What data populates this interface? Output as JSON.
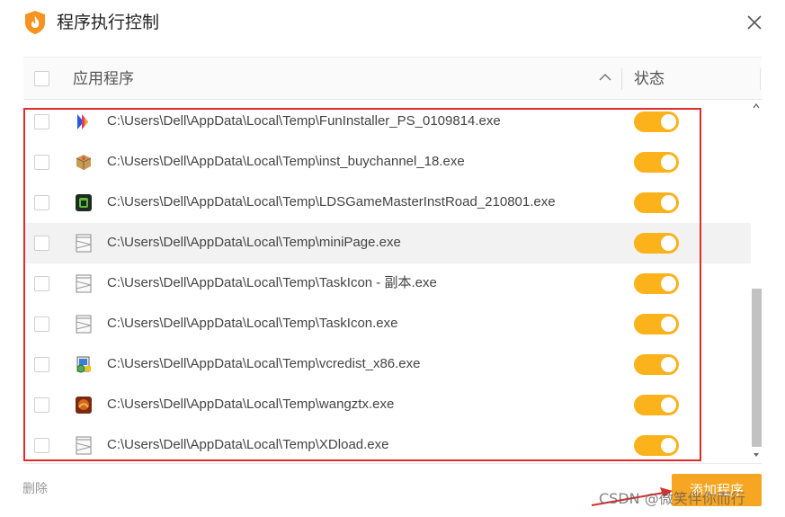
{
  "window": {
    "title": "程序执行控制",
    "icons": {
      "logo": "shield-flame-logo-icon",
      "close": "close-icon"
    }
  },
  "table": {
    "headers": {
      "app": "应用程序",
      "status": "状态"
    },
    "sort": "ascending",
    "rows": [
      {
        "path": "C:\\Users\\Dell\\AppData\\Local\\Temp\\FunInstaller_PS_0109814.exe",
        "icon": "funinstaller-app-icon",
        "checked": false,
        "enabled": true
      },
      {
        "path": "C:\\Users\\Dell\\AppData\\Local\\Temp\\inst_buychannel_18.exe",
        "icon": "package-box-icon",
        "checked": false,
        "enabled": true
      },
      {
        "path": "C:\\Users\\Dell\\AppData\\Local\\Temp\\LDSGameMasterInstRoad_210801.exe",
        "icon": "ldsgamemaster-app-icon",
        "checked": false,
        "enabled": true
      },
      {
        "path": "C:\\Users\\Dell\\AppData\\Local\\Temp\\miniPage.exe",
        "icon": "generic-exe-file-icon",
        "checked": false,
        "enabled": true
      },
      {
        "path": "C:\\Users\\Dell\\AppData\\Local\\Temp\\TaskIcon - 副本.exe",
        "icon": "generic-exe-file-icon",
        "checked": false,
        "enabled": true
      },
      {
        "path": "C:\\Users\\Dell\\AppData\\Local\\Temp\\TaskIcon.exe",
        "icon": "generic-exe-file-icon",
        "checked": false,
        "enabled": true
      },
      {
        "path": "C:\\Users\\Dell\\AppData\\Local\\Temp\\vcredist_x86.exe",
        "icon": "installer-setup-icon",
        "checked": false,
        "enabled": true
      },
      {
        "path": "C:\\Users\\Dell\\AppData\\Local\\Temp\\wangztx.exe",
        "icon": "game-app-icon",
        "checked": false,
        "enabled": true
      },
      {
        "path": "C:\\Users\\Dell\\AppData\\Local\\Temp\\XDload.exe",
        "icon": "generic-exe-file-icon",
        "checked": false,
        "enabled": true
      }
    ]
  },
  "footer": {
    "delete_label": "删除",
    "add_label": "添加程序"
  },
  "watermark": "CSDN @微笑伴你而行",
  "colors": {
    "toggle_on": "#fbb21b",
    "add_button": "#f6a623",
    "annotation": "#e02c2c",
    "hover_row": "#f2f2f2"
  }
}
